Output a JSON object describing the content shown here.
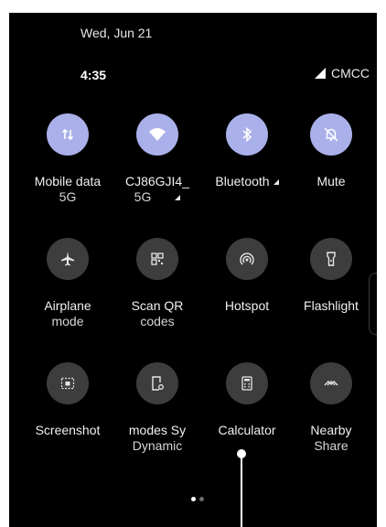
{
  "status": {
    "date": "Wed, Jun 21",
    "time": "4:35",
    "carrier": "CMCC"
  },
  "tiles": [
    {
      "name": "Mobile data",
      "sub": "5G",
      "state": "on",
      "icon": "mobile-data-icon"
    },
    {
      "name": "CJ86GJI4_",
      "sub": "5G",
      "state": "on",
      "icon": "wifi-icon"
    },
    {
      "name": "Bluetooth",
      "sub": "",
      "state": "on",
      "icon": "bluetooth-icon"
    },
    {
      "name": "Mute",
      "sub": "",
      "state": "on",
      "icon": "mute-bell-icon"
    },
    {
      "name": "Airplane",
      "sub": "mode",
      "state": "off",
      "icon": "airplane-icon"
    },
    {
      "name": "Scan QR",
      "sub": "codes",
      "state": "off",
      "icon": "qr-scan-icon"
    },
    {
      "name": "Hotspot",
      "sub": "",
      "state": "off",
      "icon": "hotspot-icon"
    },
    {
      "name": "Flashlight",
      "sub": "",
      "state": "off",
      "icon": "flashlight-icon"
    },
    {
      "name": "Screenshot",
      "sub": "",
      "state": "off",
      "icon": "screenshot-icon"
    },
    {
      "name": "modes   Sy",
      "sub": "Dynamic",
      "state": "off",
      "icon": "dynamic-modes-icon"
    },
    {
      "name": "Calculator",
      "sub": "",
      "state": "off",
      "icon": "calculator-icon"
    },
    {
      "name": "Nearby",
      "sub": "Share",
      "state": "off",
      "icon": "nearby-share-icon"
    }
  ],
  "pager": {
    "current_page": 1,
    "total_pages": 2
  },
  "colors": {
    "active_tile": "#aab0ea",
    "inactive_tile": "#3d3d3d",
    "panel_bg": "#000000"
  }
}
